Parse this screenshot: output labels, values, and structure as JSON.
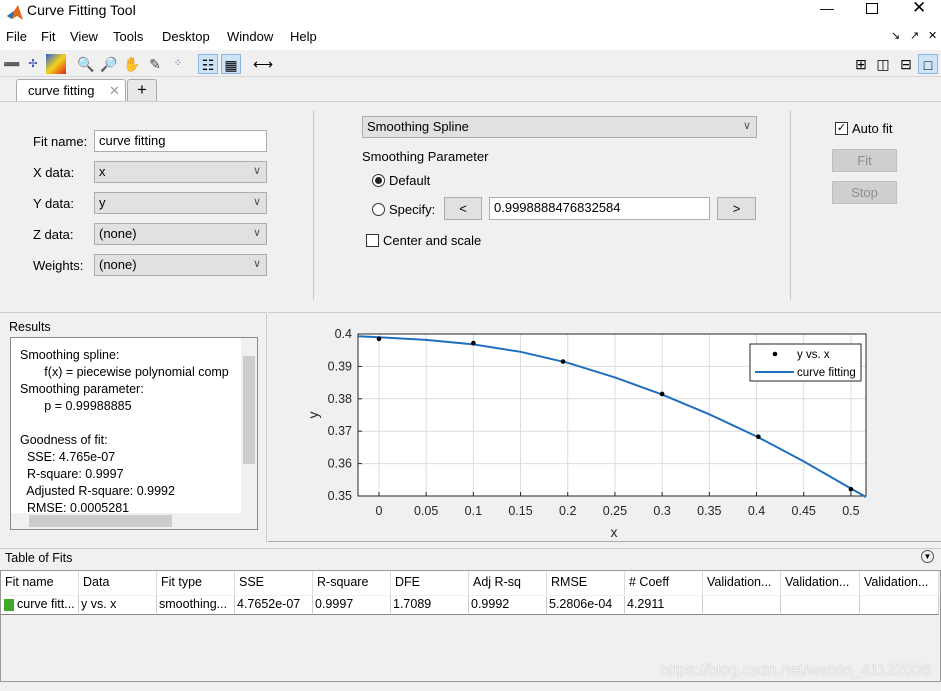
{
  "window": {
    "title": "Curve Fitting Tool",
    "controls": [
      "minimize",
      "maximize",
      "close"
    ]
  },
  "menu": [
    "File",
    "Fit",
    "View",
    "Tools",
    "Desktop",
    "Window",
    "Help"
  ],
  "toolbar_icons": [
    "data-cursor-icon",
    "exclude-outliers-icon",
    "colormap-icon",
    "zoom-in-icon",
    "zoom-out-icon",
    "pan-icon",
    "data-cursor-icon",
    "exclude-icon",
    "legend-icon",
    "grid-icon",
    "axes-limits-icon"
  ],
  "tabs": [
    {
      "label": "curve fitting",
      "active": true
    }
  ],
  "fit": {
    "fit_name_label": "Fit name:",
    "fit_name": "curve fitting",
    "x_label": "X data:",
    "x_value": "x",
    "y_label": "Y data:",
    "y_value": "y",
    "z_label": "Z data:",
    "z_value": "(none)",
    "w_label": "Weights:",
    "w_value": "(none)",
    "fit_type": "Smoothing Spline",
    "smoothing_title": "Smoothing Parameter",
    "default_label": "Default",
    "default_selected": true,
    "specify_label": "Specify:",
    "specify_value": "0.9998888476832584",
    "dec_label": "<",
    "inc_label": ">",
    "center_scale_label": "Center and scale",
    "center_scale_checked": false,
    "auto_fit_label": "Auto fit",
    "auto_fit_checked": true,
    "fit_button": "Fit",
    "stop_button": "Stop"
  },
  "results": {
    "title": "Results",
    "text": "Smoothing spline:\n       f(x) = piecewise polynomial comp\nSmoothing parameter:\n       p = 0.99988885\n\nGoodness of fit:\n  SSE: 4.765e-07\n  R-square: 0.9997\n  Adjusted R-square: 0.9992\n  RMSE: 0.0005281"
  },
  "chart_data": {
    "type": "scatter",
    "xlabel": "x",
    "ylabel": "y",
    "xlim": [
      -0.0222,
      0.516
    ],
    "ylim": [
      0.35,
      0.4
    ],
    "xticks": [
      "0",
      "0.05",
      "0.1",
      "0.15",
      "0.2",
      "0.25",
      "0.3",
      "0.35",
      "0.4",
      "0.45",
      "0.5"
    ],
    "yticks": [
      "0.35",
      "0.36",
      "0.37",
      "0.38",
      "0.39",
      "0.4"
    ],
    "grid": true,
    "legend_position": "top-right",
    "series": [
      {
        "name": "y vs. x",
        "kind": "points",
        "color": "#000000",
        "x": [
          0,
          0.1,
          0.195,
          0.3,
          0.402,
          0.5
        ],
        "y": [
          0.3985,
          0.3972,
          0.3915,
          0.3815,
          0.3683,
          0.3521
        ]
      },
      {
        "name": "curve fitting",
        "kind": "line",
        "color": "#1f6fbf",
        "x": [
          -0.0222,
          0,
          0.05,
          0.1,
          0.15,
          0.2,
          0.25,
          0.3,
          0.35,
          0.4,
          0.45,
          0.5,
          0.516
        ],
        "y": [
          0.3993,
          0.399,
          0.3982,
          0.3968,
          0.3945,
          0.3911,
          0.3866,
          0.3813,
          0.3752,
          0.3684,
          0.3607,
          0.3523,
          0.3497
        ]
      }
    ]
  },
  "table": {
    "title": "Table of Fits",
    "columns": [
      "Fit name",
      "Data",
      "Fit type",
      "SSE",
      "R-square",
      "DFE",
      "Adj R-sq",
      "RMSE",
      "# Coeff",
      "Validation...",
      "Validation...",
      "Validation..."
    ],
    "rows": [
      [
        "curve fitt...",
        "y vs. x",
        "smoothing...",
        "4.7652e-07",
        "0.9997",
        "1.7089",
        "0.9992",
        "5.2806e-04",
        "4.2911",
        "",
        "",
        ""
      ]
    ],
    "row_color": "#3faa2a"
  },
  "watermark": "https://blog.csdn.net/weixin_41122036"
}
